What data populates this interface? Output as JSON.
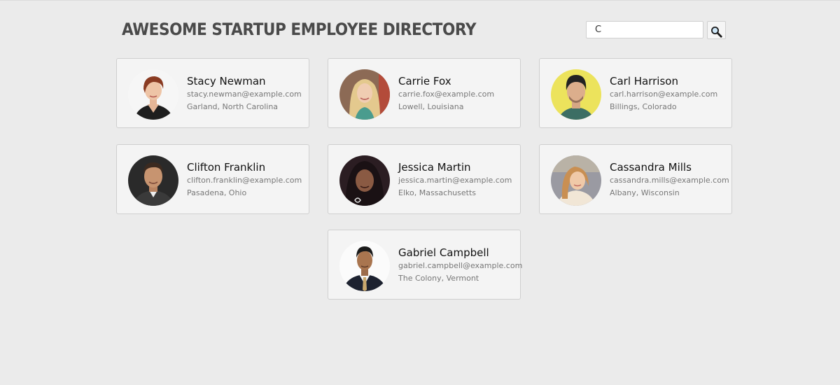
{
  "header": {
    "title": "AWESOME STARTUP EMPLOYEE DIRECTORY"
  },
  "search": {
    "value": "C",
    "button_icon": "magnifier-icon"
  },
  "employees": [
    {
      "name": "Stacy Newman",
      "email": "stacy.newman@example.com",
      "location": "Garland, North Carolina"
    },
    {
      "name": "Carrie Fox",
      "email": "carrie.fox@example.com",
      "location": "Lowell, Louisiana"
    },
    {
      "name": "Carl Harrison",
      "email": "carl.harrison@example.com",
      "location": "Billings, Colorado"
    },
    {
      "name": "Clifton Franklin",
      "email": "clifton.franklin@example.com",
      "location": "Pasadena, Ohio"
    },
    {
      "name": "Jessica Martin",
      "email": "jessica.martin@example.com",
      "location": "Elko, Massachusetts"
    },
    {
      "name": "Cassandra Mills",
      "email": "cassandra.mills@example.com",
      "location": "Albany, Wisconsin"
    },
    {
      "name": "Gabriel Campbell",
      "email": "gabriel.campbell@example.com",
      "location": "The Colony, Vermont"
    }
  ],
  "colors": {
    "background": "#ebebeb",
    "card": "#f4f4f4",
    "title": "#4a4a4a"
  }
}
